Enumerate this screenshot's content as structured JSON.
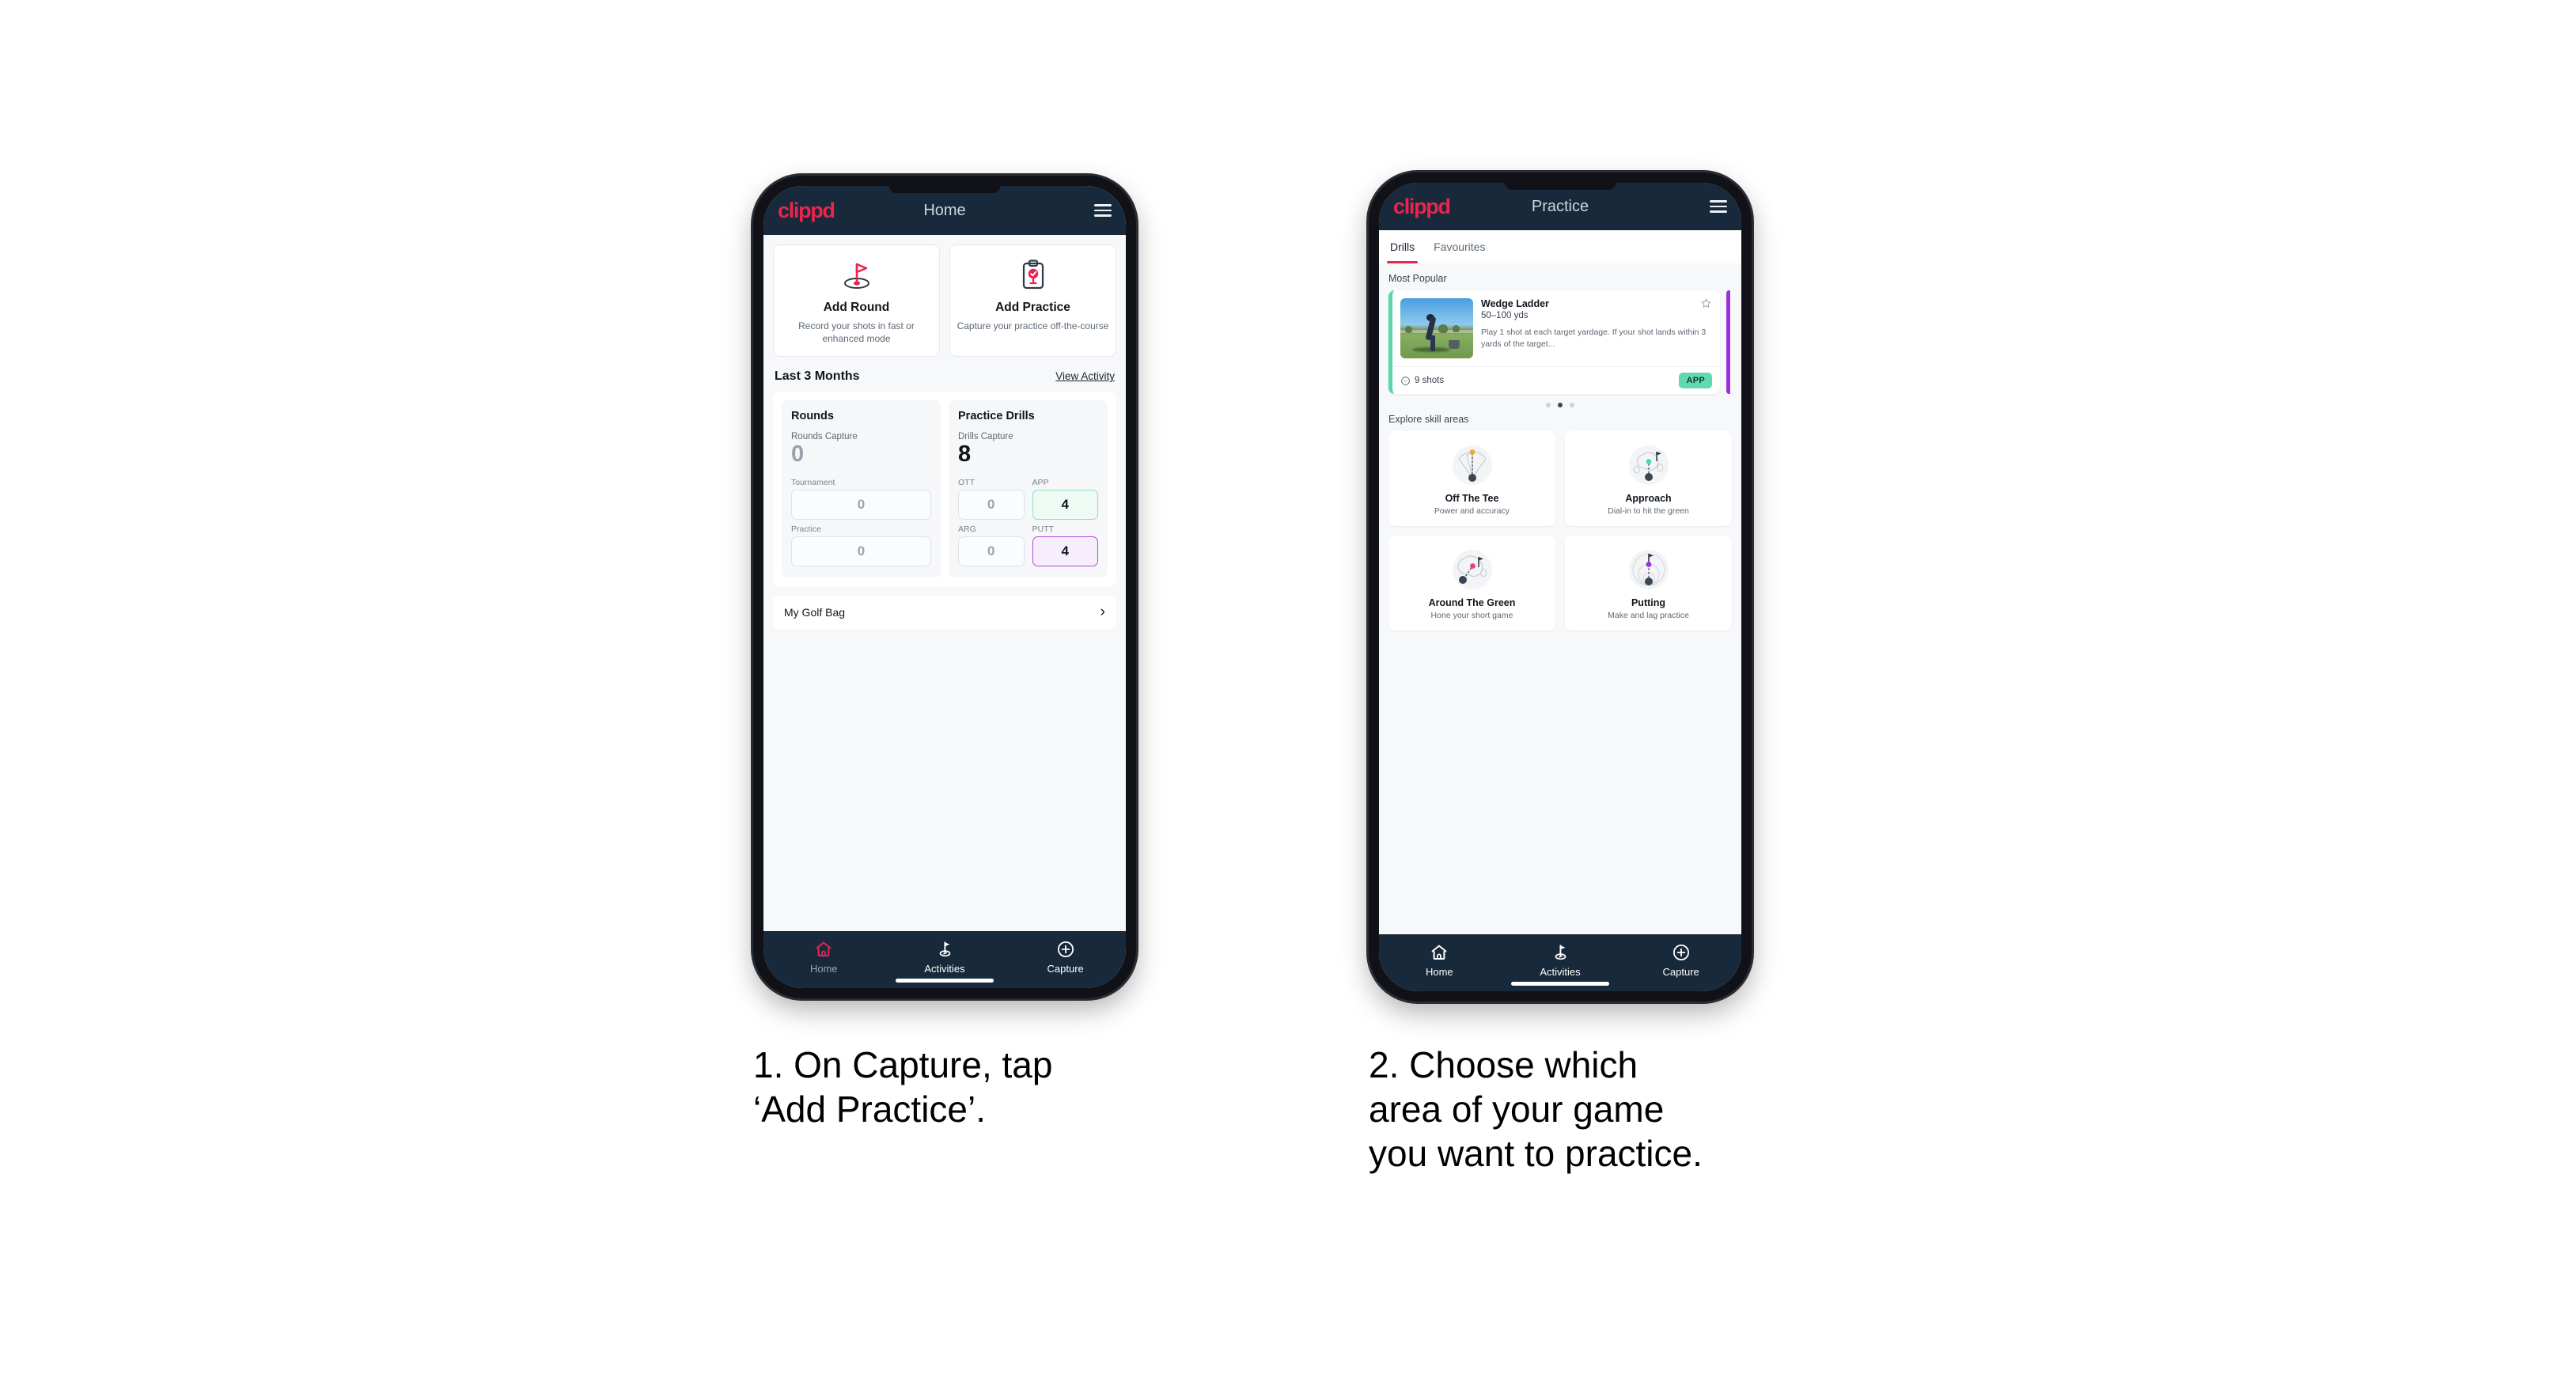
{
  "phones": [
    {
      "id": "home",
      "appbar": {
        "logo": "clippd",
        "title": "Home",
        "menu_icon": "hamburger-icon"
      },
      "quick_actions": [
        {
          "icon": "golf-flag-icon",
          "title": "Add Round",
          "subtitle": "Record your shots in fast or enhanced mode"
        },
        {
          "icon": "clipboard-check-icon",
          "title": "Add Practice",
          "subtitle": "Capture your practice off-the-course"
        }
      ],
      "section": {
        "title": "Last 3 Months",
        "link": "View Activity"
      },
      "stats": [
        {
          "title": "Rounds",
          "capture_label": "Rounds Capture",
          "capture_value": "0",
          "capture_is_zero": true,
          "metrics": [
            {
              "label": "Tournament",
              "value": "0",
              "state": "zero"
            },
            {
              "label": "Practice",
              "value": "0",
              "state": "zero"
            }
          ]
        },
        {
          "title": "Practice Drills",
          "capture_label": "Drills Capture",
          "capture_value": "8",
          "capture_is_zero": false,
          "metrics": [
            {
              "label": "OTT",
              "value": "0",
              "state": "zero"
            },
            {
              "label": "APP",
              "value": "4",
              "state": "green"
            },
            {
              "label": "ARG",
              "value": "0",
              "state": "zero"
            },
            {
              "label": "PUTT",
              "value": "4",
              "state": "purple"
            }
          ]
        }
      ],
      "golf_bag": {
        "label": "My Golf Bag",
        "chevron": "chevron-right-icon"
      },
      "nav": [
        {
          "icon": "home-icon",
          "label": "Home",
          "active": true,
          "accent": "#e8254f",
          "label_dim": true
        },
        {
          "icon": "golf-activities-icon",
          "label": "Activities",
          "active": false,
          "accent": "#ffffff",
          "label_dim": false
        },
        {
          "icon": "plus-circle-icon",
          "label": "Capture",
          "active": false,
          "accent": "#ffffff",
          "label_dim": false
        }
      ]
    },
    {
      "id": "practice",
      "appbar": {
        "logo": "clippd",
        "title": "Practice",
        "menu_icon": "hamburger-icon"
      },
      "tabs": [
        {
          "label": "Drills",
          "active": true
        },
        {
          "label": "Favourites",
          "active": false
        }
      ],
      "most_popular_label": "Most Popular",
      "drill": {
        "title": "Wedge Ladder",
        "range": "50–100 yds",
        "description": "Play 1 shot at each target yardage. If your shot lands within 3 yards of the target...",
        "shots": "9 shots",
        "shots_icon": "golf-ball-icon",
        "tag": "APP",
        "tag_color": "#5fd9af",
        "accent_color": "#57d6a8",
        "next_accent_color": "#9b30e0",
        "favourite_icon": "star-outline-icon"
      },
      "carousel_dots": {
        "count": 3,
        "active_index": 1
      },
      "skill_label": "Explore skill areas",
      "skills": [
        {
          "icon": "off-the-tee-icon",
          "name": "Off The Tee",
          "sub": "Power and accuracy",
          "dot_color": "#f0ad2b"
        },
        {
          "icon": "approach-icon",
          "name": "Approach",
          "sub": "Dial-in to hit the green",
          "dot_color": "#4fd6b0"
        },
        {
          "icon": "around-the-green-icon",
          "name": "Around The Green",
          "sub": "Hone your short game",
          "dot_color": "#e8446f"
        },
        {
          "icon": "putting-icon",
          "name": "Putting",
          "sub": "Make and lag practice",
          "dot_color": "#9b30e0"
        }
      ],
      "nav": [
        {
          "icon": "home-icon",
          "label": "Home",
          "active": false,
          "accent": "#ffffff",
          "label_dim": false
        },
        {
          "icon": "golf-activities-icon",
          "label": "Activities",
          "active": true,
          "accent": "#ffffff",
          "label_dim": false
        },
        {
          "icon": "plus-circle-icon",
          "label": "Capture",
          "active": false,
          "accent": "#ffffff",
          "label_dim": false
        }
      ]
    }
  ],
  "captions": [
    "1. On Capture, tap\n‘Add Practice’.",
    "2. Choose which\narea of your game\nyou want to practice."
  ],
  "colors": {
    "brand_pink": "#e8254f",
    "header_navy": "#17293a",
    "page_bg": "#f7f8fa",
    "green_accent": "#5fd9af",
    "purple_accent": "#9b30e0"
  }
}
